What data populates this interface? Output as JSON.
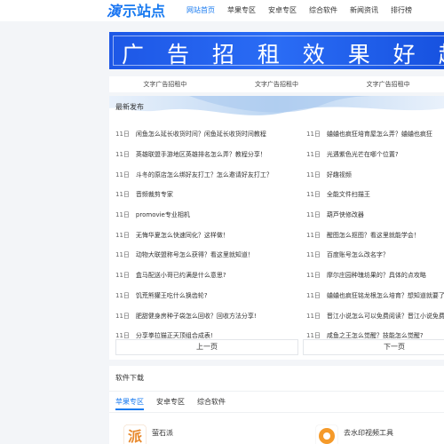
{
  "site": {
    "logo_mark": "演",
    "logo_text": "示站点"
  },
  "nav": [
    "网站首页",
    "苹果专区",
    "安卓专区",
    "综合软件",
    "新闻资讯",
    "排行榜"
  ],
  "banner": {
    "text": "广 告 招 租   效 果 好  超 赞"
  },
  "ad_links": [
    "文字广告招租中",
    "文字广告招租中",
    "文字广告招租中"
  ],
  "latest": {
    "title": "最新发布",
    "left": [
      {
        "day": "11日",
        "title": "闲鱼怎么延长收货时间？闲鱼延长收货时间教程"
      },
      {
        "day": "11日",
        "title": "英雄联盟手游地区英雄排名怎么弄？教程分享！"
      },
      {
        "day": "11日",
        "title": "斗冬的原店怎么绑好友打工？怎么邀请好友打工？"
      },
      {
        "day": "11日",
        "title": "音频裁剪专家"
      },
      {
        "day": "11日",
        "title": "promovie专业相机"
      },
      {
        "day": "11日",
        "title": "无悔华夏怎么快速同化？这样做！"
      },
      {
        "day": "11日",
        "title": "动物大联盟称号怎么获得？看这里就知道！"
      },
      {
        "day": "11日",
        "title": "盒马配送小哥已约满是什么意思?"
      },
      {
        "day": "11日",
        "title": "饥荒熊獾王吃什么换齿轮?"
      },
      {
        "day": "11日",
        "title": "肥甜健身房种子袋怎么回收？回收方法分享!"
      },
      {
        "day": "11日",
        "title": "分享拳拉猫正天顶组合成表!"
      }
    ],
    "right": [
      {
        "day": "11日",
        "title": "蛐蛐也疯狂培育屋怎么弄？蛐蛐也疯狂"
      },
      {
        "day": "11日",
        "title": "光遇紫色光芒在哪个位置?"
      },
      {
        "day": "11日",
        "title": "好趣视频"
      },
      {
        "day": "11日",
        "title": "全能文件扫描王"
      },
      {
        "day": "11日",
        "title": "葫芦侠修改器"
      },
      {
        "day": "11日",
        "title": "醒图怎么抠图？看这里就能学会！"
      },
      {
        "day": "11日",
        "title": "百度账号怎么改名字？"
      },
      {
        "day": "11日",
        "title": "摩尔庄园种瑰坊果的？具体的点攻略"
      },
      {
        "day": "11日",
        "title": "蛐蛐也疯狂铭龙根怎么培育？想知道就要了解"
      },
      {
        "day": "11日",
        "title": "晋江小说怎么可以免费阅读？晋江小说免费"
      },
      {
        "day": "11日",
        "title": "咸鱼之王怎么觉醒？技能怎么觉醒?"
      }
    ],
    "prev": "上一页",
    "next": "下一页"
  },
  "software": {
    "title": "软件下载",
    "tabs": [
      "苹果专区",
      "安卓专区",
      "综合软件"
    ],
    "apps": [
      {
        "name": "萤石派",
        "icon": "ying-shi-pai-app-icon",
        "color": "#e8892c"
      },
      {
        "name": "去水印视频工具",
        "icon": "watermark-video-tool-app-icon",
        "color": "#f59a2a"
      }
    ]
  }
}
